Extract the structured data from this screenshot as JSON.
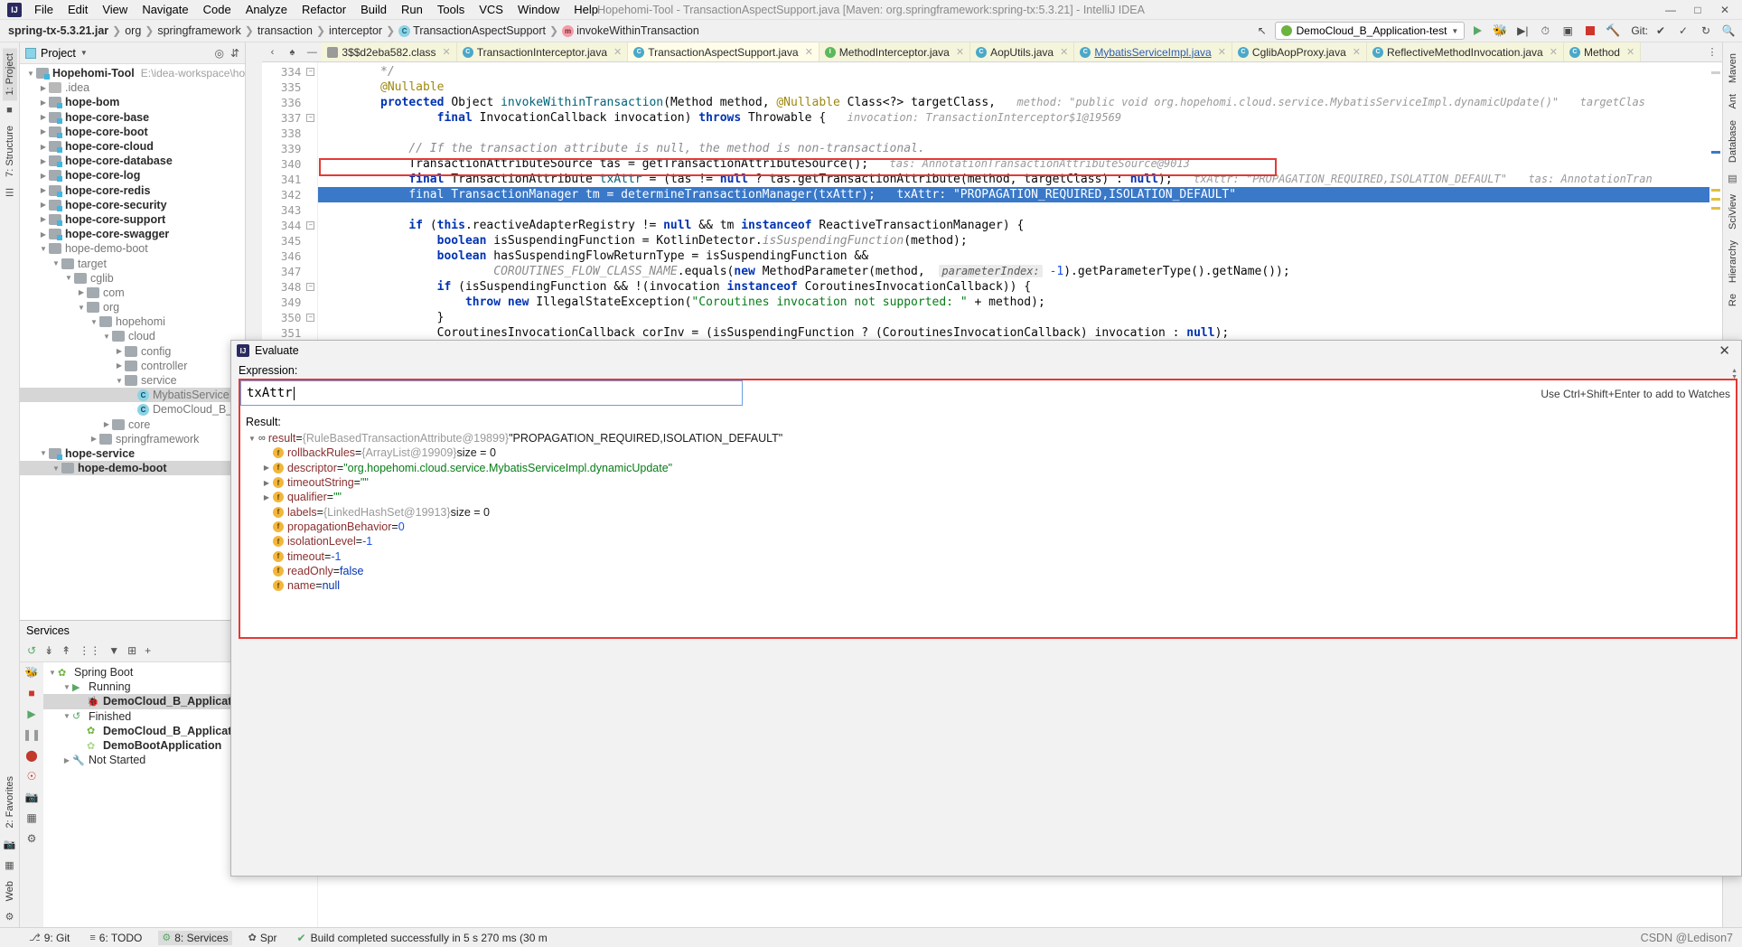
{
  "window": {
    "title": "Hopehomi-Tool - TransactionAspectSupport.java [Maven: org.springframework:spring-tx:5.3.21] - IntelliJ IDEA",
    "minimize": "—",
    "maximize": "□",
    "close": "✕"
  },
  "menu": [
    "File",
    "Edit",
    "View",
    "Navigate",
    "Code",
    "Analyze",
    "Refactor",
    "Build",
    "Run",
    "Tools",
    "VCS",
    "Window",
    "Help"
  ],
  "breadcrumbs": [
    {
      "label": "spring-tx-5.3.21.jar",
      "icon": ""
    },
    {
      "label": "org",
      "icon": ""
    },
    {
      "label": "springframework",
      "icon": ""
    },
    {
      "label": "transaction",
      "icon": ""
    },
    {
      "label": "interceptor",
      "icon": ""
    },
    {
      "label": "TransactionAspectSupport",
      "icon": "class-icon"
    },
    {
      "label": "invokeWithinTransaction",
      "icon": "method-icon"
    }
  ],
  "toolbar": {
    "run_config": "DemoCloud_B_Application-test",
    "run_label": "run-icon",
    "debug_label": "debug-icon",
    "stop_label": "stop-icon",
    "git_label": "Git:"
  },
  "left_strips": {
    "project_tab": "1: Project",
    "structure_tab": "7: Structure",
    "favorites_tab": "2: Favorites",
    "web_tab": "Web"
  },
  "right_strips": {
    "maven_tab": "Maven",
    "ant_tab": "Ant",
    "database_tab": "Database",
    "sciview_tab": "SciView",
    "hierarchy_tab": "Hierarchy",
    "re_tab": "Re"
  },
  "project_panel": {
    "title": "Project",
    "locate_icon": "crosshair-icon",
    "collapse_icon": "collapse-all-icon",
    "tree": [
      {
        "depth": 0,
        "label": "Hopehomi-Tool",
        "path": "E:\\idea-workspace\\hopehom",
        "arrow": "down",
        "icon": "module",
        "bold": true
      },
      {
        "depth": 1,
        "label": ".idea",
        "arrow": "right",
        "icon": "grey",
        "bold": false,
        "grey": true
      },
      {
        "depth": 1,
        "label": "hope-bom",
        "arrow": "right",
        "icon": "module",
        "bold": true
      },
      {
        "depth": 1,
        "label": "hope-core-base",
        "arrow": "right",
        "icon": "module",
        "bold": true
      },
      {
        "depth": 1,
        "label": "hope-core-boot",
        "arrow": "right",
        "icon": "module",
        "bold": true
      },
      {
        "depth": 1,
        "label": "hope-core-cloud",
        "arrow": "right",
        "icon": "module",
        "bold": true
      },
      {
        "depth": 1,
        "label": "hope-core-database",
        "arrow": "right",
        "icon": "module",
        "bold": true
      },
      {
        "depth": 1,
        "label": "hope-core-log",
        "arrow": "right",
        "icon": "module",
        "bold": true
      },
      {
        "depth": 1,
        "label": "hope-core-redis",
        "arrow": "right",
        "icon": "module",
        "bold": true
      },
      {
        "depth": 1,
        "label": "hope-core-security",
        "arrow": "right",
        "icon": "module",
        "bold": true
      },
      {
        "depth": 1,
        "label": "hope-core-support",
        "arrow": "right",
        "icon": "module",
        "bold": true
      },
      {
        "depth": 1,
        "label": "hope-core-swagger",
        "arrow": "right",
        "icon": "module",
        "bold": true
      },
      {
        "depth": 1,
        "label": "hope-demo-boot",
        "arrow": "down",
        "icon": "plain",
        "bold": false,
        "grey": true
      },
      {
        "depth": 2,
        "label": "target",
        "arrow": "down",
        "icon": "plain",
        "bold": false,
        "grey": true
      },
      {
        "depth": 3,
        "label": "cglib",
        "arrow": "down",
        "icon": "plain",
        "bold": false,
        "grey": true
      },
      {
        "depth": 4,
        "label": "com",
        "arrow": "right",
        "icon": "plain",
        "bold": false,
        "grey": true
      },
      {
        "depth": 4,
        "label": "org",
        "arrow": "down",
        "icon": "plain",
        "bold": false,
        "grey": true
      },
      {
        "depth": 5,
        "label": "hopehomi",
        "arrow": "down",
        "icon": "plain",
        "bold": false,
        "grey": true
      },
      {
        "depth": 6,
        "label": "cloud",
        "arrow": "down",
        "icon": "plain",
        "bold": false,
        "grey": true
      },
      {
        "depth": 7,
        "label": "config",
        "arrow": "right",
        "icon": "plain",
        "bold": false,
        "grey": true
      },
      {
        "depth": 7,
        "label": "controller",
        "arrow": "right",
        "icon": "plain",
        "bold": false,
        "grey": true
      },
      {
        "depth": 7,
        "label": "service",
        "arrow": "down",
        "icon": "plain",
        "bold": false,
        "grey": true
      },
      {
        "depth": 8,
        "label": "MybatisServiceIm",
        "arrow": "none",
        "icon": "class",
        "bold": false,
        "grey": true,
        "selected": true
      },
      {
        "depth": 8,
        "label": "DemoCloud_B_Appli",
        "arrow": "none",
        "icon": "class",
        "bold": false,
        "grey": true
      },
      {
        "depth": 6,
        "label": "core",
        "arrow": "right",
        "icon": "plain",
        "bold": false,
        "grey": true
      },
      {
        "depth": 5,
        "label": "springframework",
        "arrow": "right",
        "icon": "plain",
        "bold": false,
        "grey": true
      },
      {
        "depth": 1,
        "label": "hope-service",
        "arrow": "down",
        "icon": "module",
        "bold": true
      },
      {
        "depth": 2,
        "label": "hope-demo-boot",
        "arrow": "down",
        "icon": "plain",
        "bold": true,
        "selected": true
      }
    ]
  },
  "services_panel": {
    "title": "Services",
    "toolbar_icons": [
      "rerun-icon",
      "expand-all-icon",
      "collapse-all-icon",
      "group-icon",
      "filter-icon",
      "add-tab-icon",
      "add-icon"
    ],
    "side_icons": [
      "run-icon",
      "stop-icon",
      "resume-icon",
      "pause-icon",
      "breakpoint-icon",
      "mute-breakpoints-icon",
      "camera-icon",
      "layout-icon",
      "settings-icon"
    ],
    "tree": [
      {
        "depth": 0,
        "label": "Spring Boot",
        "arrow": "down",
        "icon": "spring",
        "bold": false
      },
      {
        "depth": 1,
        "label": "Running",
        "arrow": "down",
        "icon": "run",
        "bold": false
      },
      {
        "depth": 2,
        "label": "DemoCloud_B_Application-te",
        "arrow": "none",
        "icon": "debug",
        "bold": true,
        "selected": true
      },
      {
        "depth": 1,
        "label": "Finished",
        "arrow": "down",
        "icon": "rerun",
        "bold": false
      },
      {
        "depth": 2,
        "label": "DemoCloud_B_Application-te",
        "arrow": "none",
        "icon": "spring",
        "bold": true
      },
      {
        "depth": 2,
        "label": "DemoBootApplication",
        "arrow": "none",
        "icon": "spring-faded",
        "bold": true
      },
      {
        "depth": 1,
        "label": "Not Started",
        "arrow": "right",
        "icon": "wrench",
        "bold": false
      }
    ]
  },
  "editor_tabs": [
    {
      "label": "3$$d2eba582.class",
      "icon": "grey",
      "active": false,
      "link": false
    },
    {
      "label": "TransactionInterceptor.java",
      "icon": "blue-c",
      "active": false,
      "link": false
    },
    {
      "label": "TransactionAspectSupport.java",
      "icon": "blue-c",
      "active": true,
      "link": false
    },
    {
      "label": "MethodInterceptor.java",
      "icon": "green-i",
      "active": false,
      "link": false
    },
    {
      "label": "AopUtils.java",
      "icon": "blue-c",
      "active": false,
      "link": false
    },
    {
      "label": "MybatisServiceImpl.java",
      "icon": "blue-c",
      "active": false,
      "link": true
    },
    {
      "label": "CglibAopProxy.java",
      "icon": "blue-c",
      "active": false,
      "link": false
    },
    {
      "label": "ReflectiveMethodInvocation.java",
      "icon": "blue-c",
      "active": false,
      "link": false
    },
    {
      "label": "Method",
      "icon": "blue-c",
      "active": false,
      "link": false
    }
  ],
  "code": {
    "first_line": 334,
    "lines": [
      {
        "n": 334,
        "fold": "minus",
        "html": "        <span class='cmt'>*/</span>"
      },
      {
        "n": 335,
        "fold": "",
        "html": "        <span class='ann'>@Nullable</span>"
      },
      {
        "n": 336,
        "fold": "",
        "html": "        <span class='kw'>protected</span> <span class='plain'>Object</span> <span class='fn'>invokeWithinTransaction</span><span class='plain'>(Method method,</span> <span class='ann'>@Nullable</span> <span class='plain'>Class&lt;?&gt; targetClass,</span>   <span class='hint'>method: \"public void org.hopehomi.cloud.service.MybatisServiceImpl.dynamicUpdate()\"</span>   <span class='hint'>targetClas</span>"
      },
      {
        "n": 337,
        "fold": "minus",
        "html": "                <span class='kw'>final</span> <span class='plain'>InvocationCallback invocation)</span> <span class='kw'>throws</span> <span class='plain'>Throwable {</span>   <span class='hint'>invocation: TransactionInterceptor$1@19569</span>"
      },
      {
        "n": 338,
        "fold": "",
        "html": ""
      },
      {
        "n": 339,
        "fold": "",
        "html": "            <span class='cmt'>// If the transaction attribute is null, the method is non-transactional.</span>"
      },
      {
        "n": 340,
        "fold": "",
        "html": "            <span class='plain'>TransactionAttributeSource tas = getTransactionAttributeSource();</span>   <span class='hint'>tas: AnnotationTransactionAttributeSource@9013</span>"
      },
      {
        "n": 341,
        "fold": "",
        "html": "            <span class='kw'>final</span> <span class='plain'>TransactionAttribute</span> <span class='fn'>txAttr</span> <span class='plain'>= (tas !=</span> <span class='kw'>null</span> <span class='plain'>? tas.getTransactionAttribute(method, targetClass) :</span> <span class='kw'>null</span><span class='plain'>);</span>   <span class='hint'>txAttr: \"PROPAGATION_REQUIRED,ISOLATION_DEFAULT\"</span>   <span class='hint'>tas: AnnotationTran</span>"
      },
      {
        "n": 342,
        "fold": "",
        "sel": true,
        "html": "            final TransactionManager tm = determineTransactionManager(txAttr);   txAttr: \"PROPAGATION_REQUIRED,ISOLATION_DEFAULT\""
      },
      {
        "n": 343,
        "fold": "",
        "html": ""
      },
      {
        "n": 344,
        "fold": "minus",
        "html": "            <span class='kw'>if</span> <span class='plain'>(</span><span class='kw'>this</span><span class='plain'>.reactiveAdapterRegistry !=</span> <span class='kw'>null</span> <span class='plain'>&amp;&amp; tm</span> <span class='kw'>instanceof</span> <span class='plain'>ReactiveTransactionManager) {</span>"
      },
      {
        "n": 345,
        "fold": "",
        "html": "                <span class='kw'>boolean</span> <span class='plain'>isSuspendingFunction = KotlinDetector.</span><span class='cmt'>isSuspendingFunction</span><span class='plain'>(method);</span>"
      },
      {
        "n": 346,
        "fold": "",
        "html": "                <span class='kw'>boolean</span> <span class='plain'>hasSuspendingFlowReturnType = isSuspendingFunction &amp;&amp;</span>"
      },
      {
        "n": 347,
        "fold": "",
        "html": "                        <span class='cmt'>COROUTINES_FLOW_CLASS_NAME</span><span class='plain'>.equals(</span><span class='kw'>new</span> <span class='plain'>MethodParameter(method,</span>  <span class='hintbox'>parameterIndex:</span> <span class='num'>-1</span><span class='plain'>).getParameterType().getName());</span>"
      },
      {
        "n": 348,
        "fold": "minus",
        "html": "                <span class='kw'>if</span> <span class='plain'>(isSuspendingFunction &amp;&amp; !(invocation</span> <span class='kw'>instanceof</span> <span class='plain'>CoroutinesInvocationCallback)) {</span>"
      },
      {
        "n": 349,
        "fold": "",
        "html": "                    <span class='kw'>throw</span> <span class='kw'>new</span> <span class='plain'>IllegalStateException(</span><span class='str'>\"Coroutines invocation not supported: \"</span> <span class='plain'>+ method);</span>"
      },
      {
        "n": 350,
        "fold": "minus",
        "html": "                <span class='plain'>}</span>"
      },
      {
        "n": 351,
        "fold": "",
        "html": "                <span class='plain'>CoroutinesInvocationCallback corInv = (isSuspendingFunction ? (CoroutinesInvocationCallback) invocation :</span> <span class='kw'>null</span><span class='plain'>);</span>"
      }
    ]
  },
  "evaluate": {
    "title": "Evaluate",
    "expression_label": "Expression:",
    "expression_value": "txAttr",
    "result_label": "Result:",
    "hint": "Use Ctrl+Shift+Enter to add to Watches",
    "close": "✕",
    "result_tree": [
      {
        "depth": 0,
        "arrow": "down",
        "badge": "oo",
        "name": "result",
        "eq": " = ",
        "ref": "{RuleBasedTransactionAttribute@19899}",
        "value": "\"PROPAGATION_REQUIRED,ISOLATION_DEFAULT\"",
        "vtype": "plainstr"
      },
      {
        "depth": 1,
        "arrow": "none",
        "badge": "f",
        "name": "rollbackRules",
        "eq": " = ",
        "ref": "{ArrayList@19909}",
        "value": "size = 0",
        "vtype": "plain"
      },
      {
        "depth": 1,
        "arrow": "right",
        "badge": "f",
        "name": "descriptor",
        "eq": " = ",
        "ref": "",
        "value": "\"org.hopehomi.cloud.service.MybatisServiceImpl.dynamicUpdate\"",
        "vtype": "str"
      },
      {
        "depth": 1,
        "arrow": "right",
        "badge": "f",
        "name": "timeoutString",
        "eq": " = ",
        "ref": "",
        "value": "\"\"",
        "vtype": "str"
      },
      {
        "depth": 1,
        "arrow": "right",
        "badge": "f",
        "name": "qualifier",
        "eq": " = ",
        "ref": "",
        "value": "\"\"",
        "vtype": "str"
      },
      {
        "depth": 1,
        "arrow": "none",
        "badge": "f",
        "name": "labels",
        "eq": " = ",
        "ref": "{LinkedHashSet@19913}",
        "value": "size = 0",
        "vtype": "plain"
      },
      {
        "depth": 1,
        "arrow": "none",
        "badge": "f",
        "name": "propagationBehavior",
        "eq": " = ",
        "ref": "",
        "value": "0",
        "vtype": "num"
      },
      {
        "depth": 1,
        "arrow": "none",
        "badge": "f",
        "name": "isolationLevel",
        "eq": " = ",
        "ref": "",
        "value": "-1",
        "vtype": "num"
      },
      {
        "depth": 1,
        "arrow": "none",
        "badge": "f",
        "name": "timeout",
        "eq": " = ",
        "ref": "",
        "value": "-1",
        "vtype": "num"
      },
      {
        "depth": 1,
        "arrow": "none",
        "badge": "f",
        "name": "readOnly",
        "eq": " = ",
        "ref": "",
        "value": "false",
        "vtype": "kw"
      },
      {
        "depth": 1,
        "arrow": "none",
        "badge": "f",
        "name": "name",
        "eq": " = ",
        "ref": "",
        "value": "null",
        "vtype": "kw"
      }
    ]
  },
  "statusbar": {
    "tabs": [
      {
        "label": "9: Git",
        "icon": "git-icon",
        "selected": false
      },
      {
        "label": "6: TODO",
        "icon": "todo-icon",
        "selected": false
      },
      {
        "label": "8: Services",
        "icon": "services-icon",
        "selected": true
      },
      {
        "label": "Spr",
        "icon": "spring-icon",
        "selected": false
      }
    ],
    "message": "Build completed successfully in 5 s 270 ms (30 m",
    "watermark": "CSDN @Ledison7"
  },
  "colors": {
    "accent_blue": "#3a78c8",
    "red_highlight": "#e53935",
    "tab_yellow": "#f5f5dc",
    "green_run": "#59a869"
  }
}
